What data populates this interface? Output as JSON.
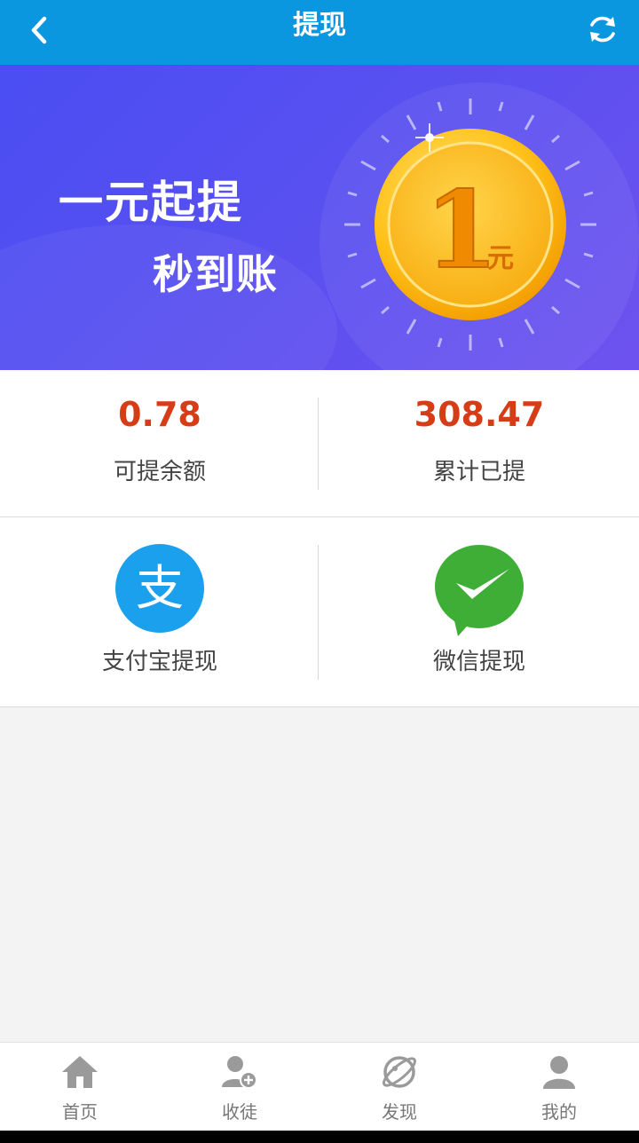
{
  "header": {
    "title": "提现",
    "back_icon": "chevron-left-icon",
    "refresh_icon": "refresh-icon",
    "background": "#0a97e0"
  },
  "banner": {
    "line1": "一元起提",
    "line2": "秒到账",
    "coin_number": "1",
    "coin_unit": "元"
  },
  "stats": {
    "available": {
      "amount": "0.78",
      "label": "可提余额"
    },
    "total": {
      "amount": "308.47",
      "label": "累计已提"
    },
    "amount_color": "#d63d17"
  },
  "methods": {
    "alipay": {
      "label": "支付宝提现",
      "icon": "alipay-icon",
      "icon_char": "支",
      "color": "#1aa0ec"
    },
    "wechat": {
      "label": "微信提现",
      "icon": "wechat-pay-icon",
      "color": "#3fae36"
    }
  },
  "tabbar": {
    "items": [
      {
        "label": "首页",
        "icon": "home-icon"
      },
      {
        "label": "收徒",
        "icon": "add-user-icon"
      },
      {
        "label": "发现",
        "icon": "discover-icon"
      },
      {
        "label": "我的",
        "icon": "user-icon"
      }
    ]
  }
}
